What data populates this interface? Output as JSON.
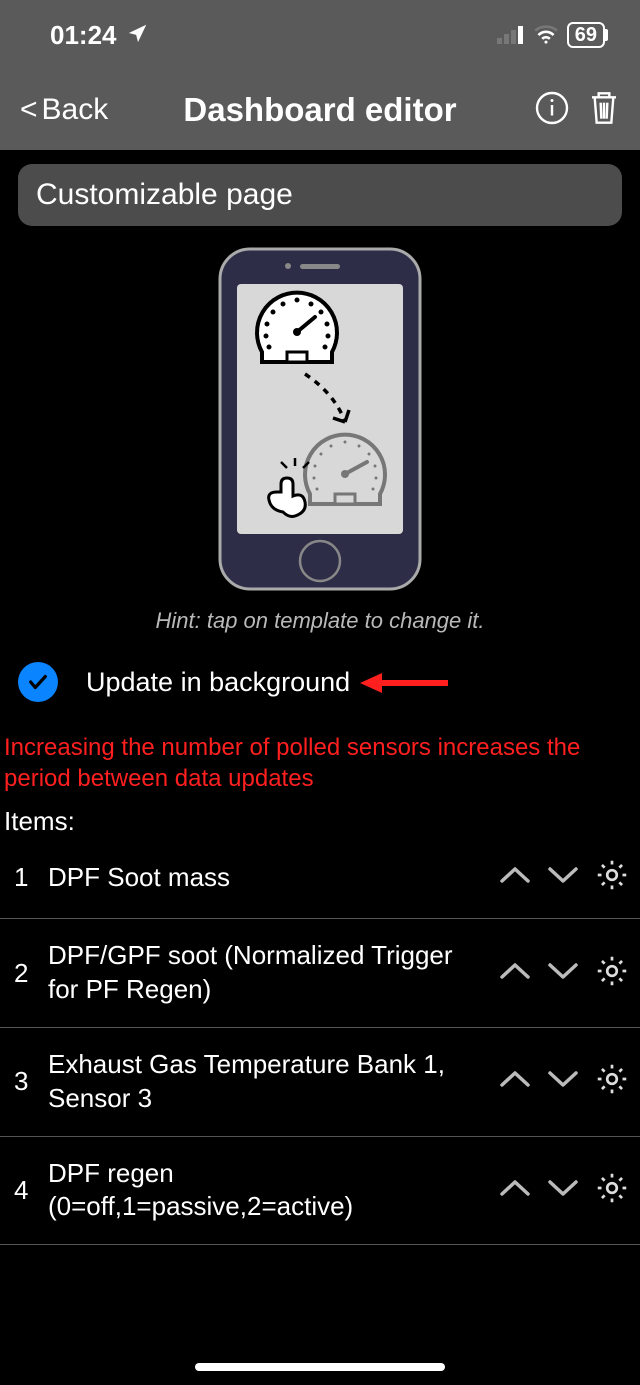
{
  "status": {
    "time": "01:24",
    "battery": "69"
  },
  "nav": {
    "back": "Back",
    "title": "Dashboard editor"
  },
  "section_header": "Customizable page",
  "hint": "Hint: tap on template to change it.",
  "checkbox": {
    "label": "Update in background",
    "checked": true
  },
  "warning": "Increasing the number of polled sensors increases the period between data updates",
  "items_label": "Items:",
  "items": [
    {
      "index": "1",
      "label": "DPF Soot mass"
    },
    {
      "index": "2",
      "label": "DPF/GPF soot (Normalized Trigger for PF Regen)"
    },
    {
      "index": "3",
      "label": "Exhaust Gas Temperature Bank 1, Sensor 3"
    },
    {
      "index": "4",
      "label": "DPF regen (0=off,1=passive,2=active)"
    }
  ]
}
